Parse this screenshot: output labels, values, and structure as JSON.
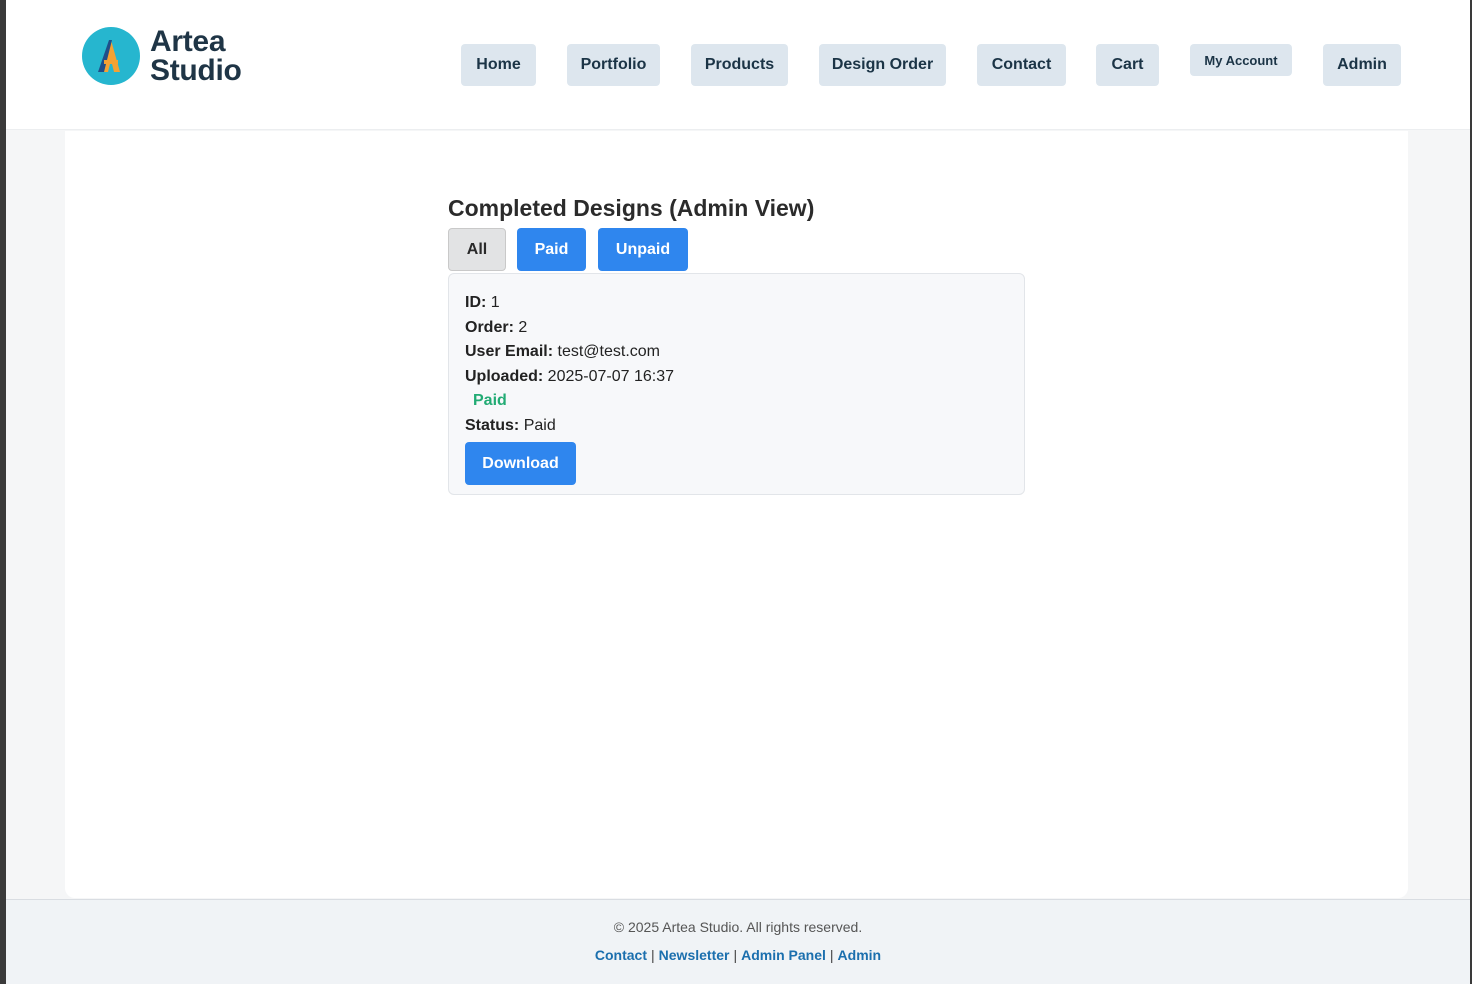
{
  "brand": {
    "line1": "Artea",
    "line2": "Studio",
    "logo_colors": {
      "circle": "#26b6cf",
      "letter": "#f4a234",
      "letter_dark": "#1f4f8a"
    }
  },
  "nav": {
    "home": "Home",
    "portfolio": "Portfolio",
    "products": "Products",
    "design_order": "Design Order",
    "contact": "Contact",
    "cart": "Cart",
    "my_account": "My Account",
    "admin": "Admin"
  },
  "page": {
    "title": "Completed Designs (Admin View)",
    "filters": {
      "all": "All",
      "paid": "Paid",
      "unpaid": "Unpaid"
    }
  },
  "designs": [
    {
      "id_label": "ID:",
      "id": "1",
      "order_label": "Order:",
      "order": "2",
      "email_label": "User Email:",
      "email": "test@test.com",
      "uploaded_label": "Uploaded:",
      "uploaded": "2025-07-07 16:37",
      "payment_badge": "Paid",
      "status_label": "Status:",
      "status": "Paid",
      "download_label": "Download"
    }
  ],
  "footer": {
    "copyright": "© 2025 Artea Studio. All rights reserved.",
    "links": {
      "contact": "Contact",
      "newsletter": "Newsletter",
      "admin_panel": "Admin Panel",
      "admin": "Admin"
    },
    "separator": "|"
  },
  "colors": {
    "accent": "#2f86ee",
    "nav_bg": "#dde6ee",
    "paid_green": "#22ab74",
    "link_blue": "#1b6fae"
  }
}
